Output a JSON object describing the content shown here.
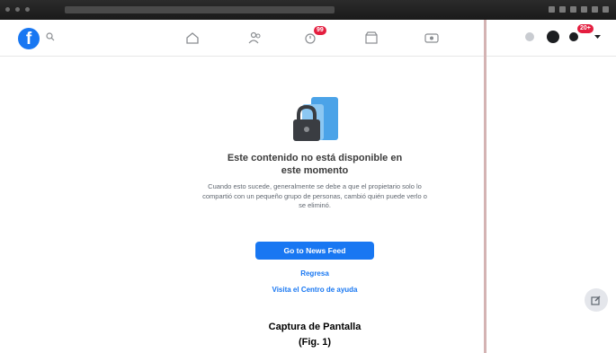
{
  "header": {
    "notification_badge": "99",
    "messenger_badge": "20+"
  },
  "content": {
    "title_line1": "Este contenido no está disponible en",
    "title_line2": "este momento",
    "body": "Cuando esto sucede, generalmente se debe a que el propietario solo lo compartió con un pequeño grupo de personas, cambió quién puede verlo o se eliminó.",
    "primary_button": "Go to News Feed",
    "back_link": "Regresa",
    "help_link": "Visita el Centro de ayuda"
  },
  "caption": {
    "line1": "Captura de Pantalla",
    "line2": "(Fig. 1)"
  },
  "colors": {
    "brand": "#1877f2",
    "badge": "#e41e3f"
  }
}
